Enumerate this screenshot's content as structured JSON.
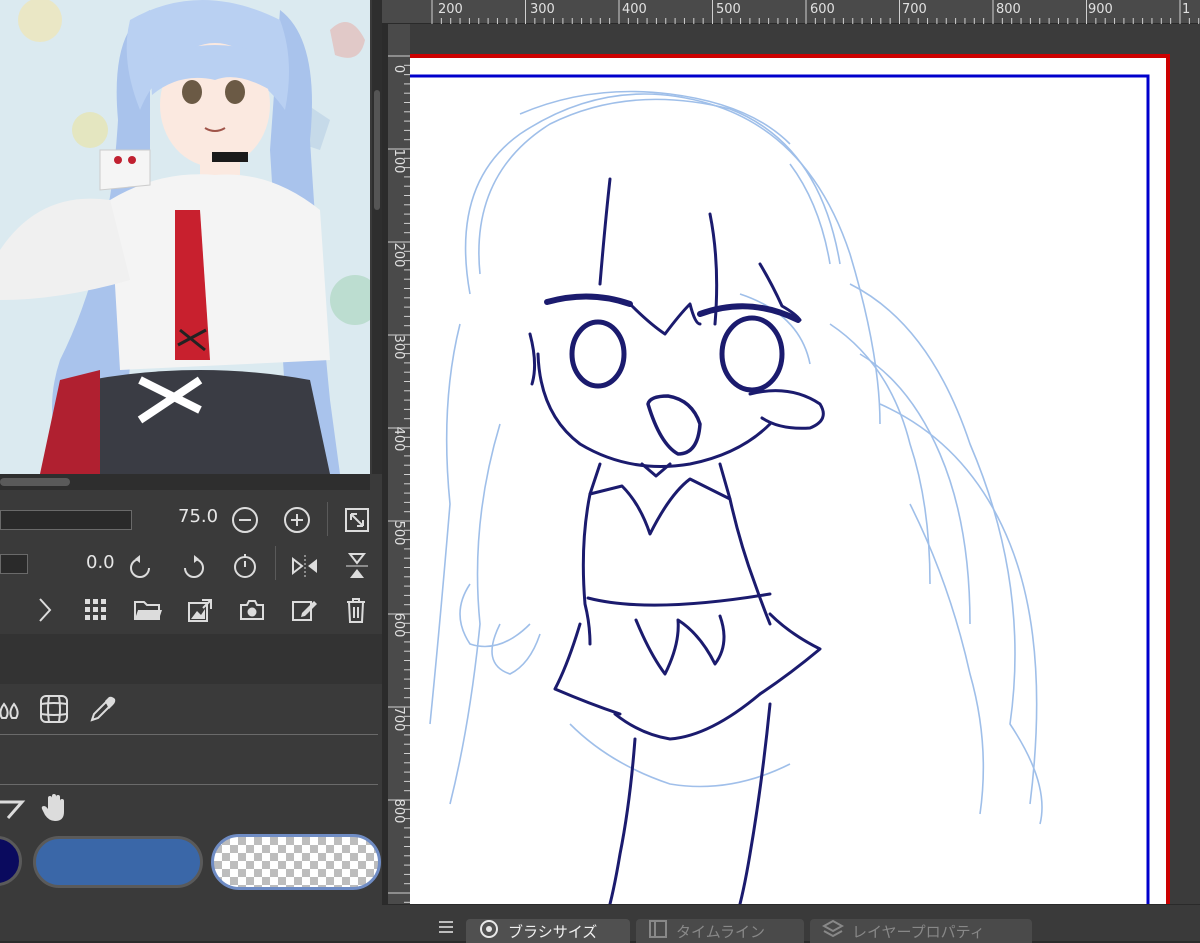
{
  "navigator": {
    "zoom_value": "75.0",
    "rotation_value": "0.0"
  },
  "ruler": {
    "top_ticks": [
      "200",
      "300",
      "400",
      "500",
      "600",
      "700",
      "800",
      "900",
      "1"
    ],
    "left_ticks": [
      "0",
      "100",
      "200",
      "300",
      "400",
      "500",
      "600",
      "700",
      "800"
    ]
  },
  "bottom_tabs": [
    {
      "label": "ブラシサイズ",
      "icon": "brush-size-icon"
    },
    {
      "label": "タイムライン",
      "icon": "timeline-icon"
    },
    {
      "label": "レイヤープロパティ",
      "icon": "layer-property-icon"
    }
  ],
  "colors": {
    "main_color": "#0a0a5e",
    "sub_color": "#3a67a8",
    "transparent_color": "checker",
    "canvas_border_red": "#cc0000",
    "canvas_border_blue": "#0000cc"
  }
}
